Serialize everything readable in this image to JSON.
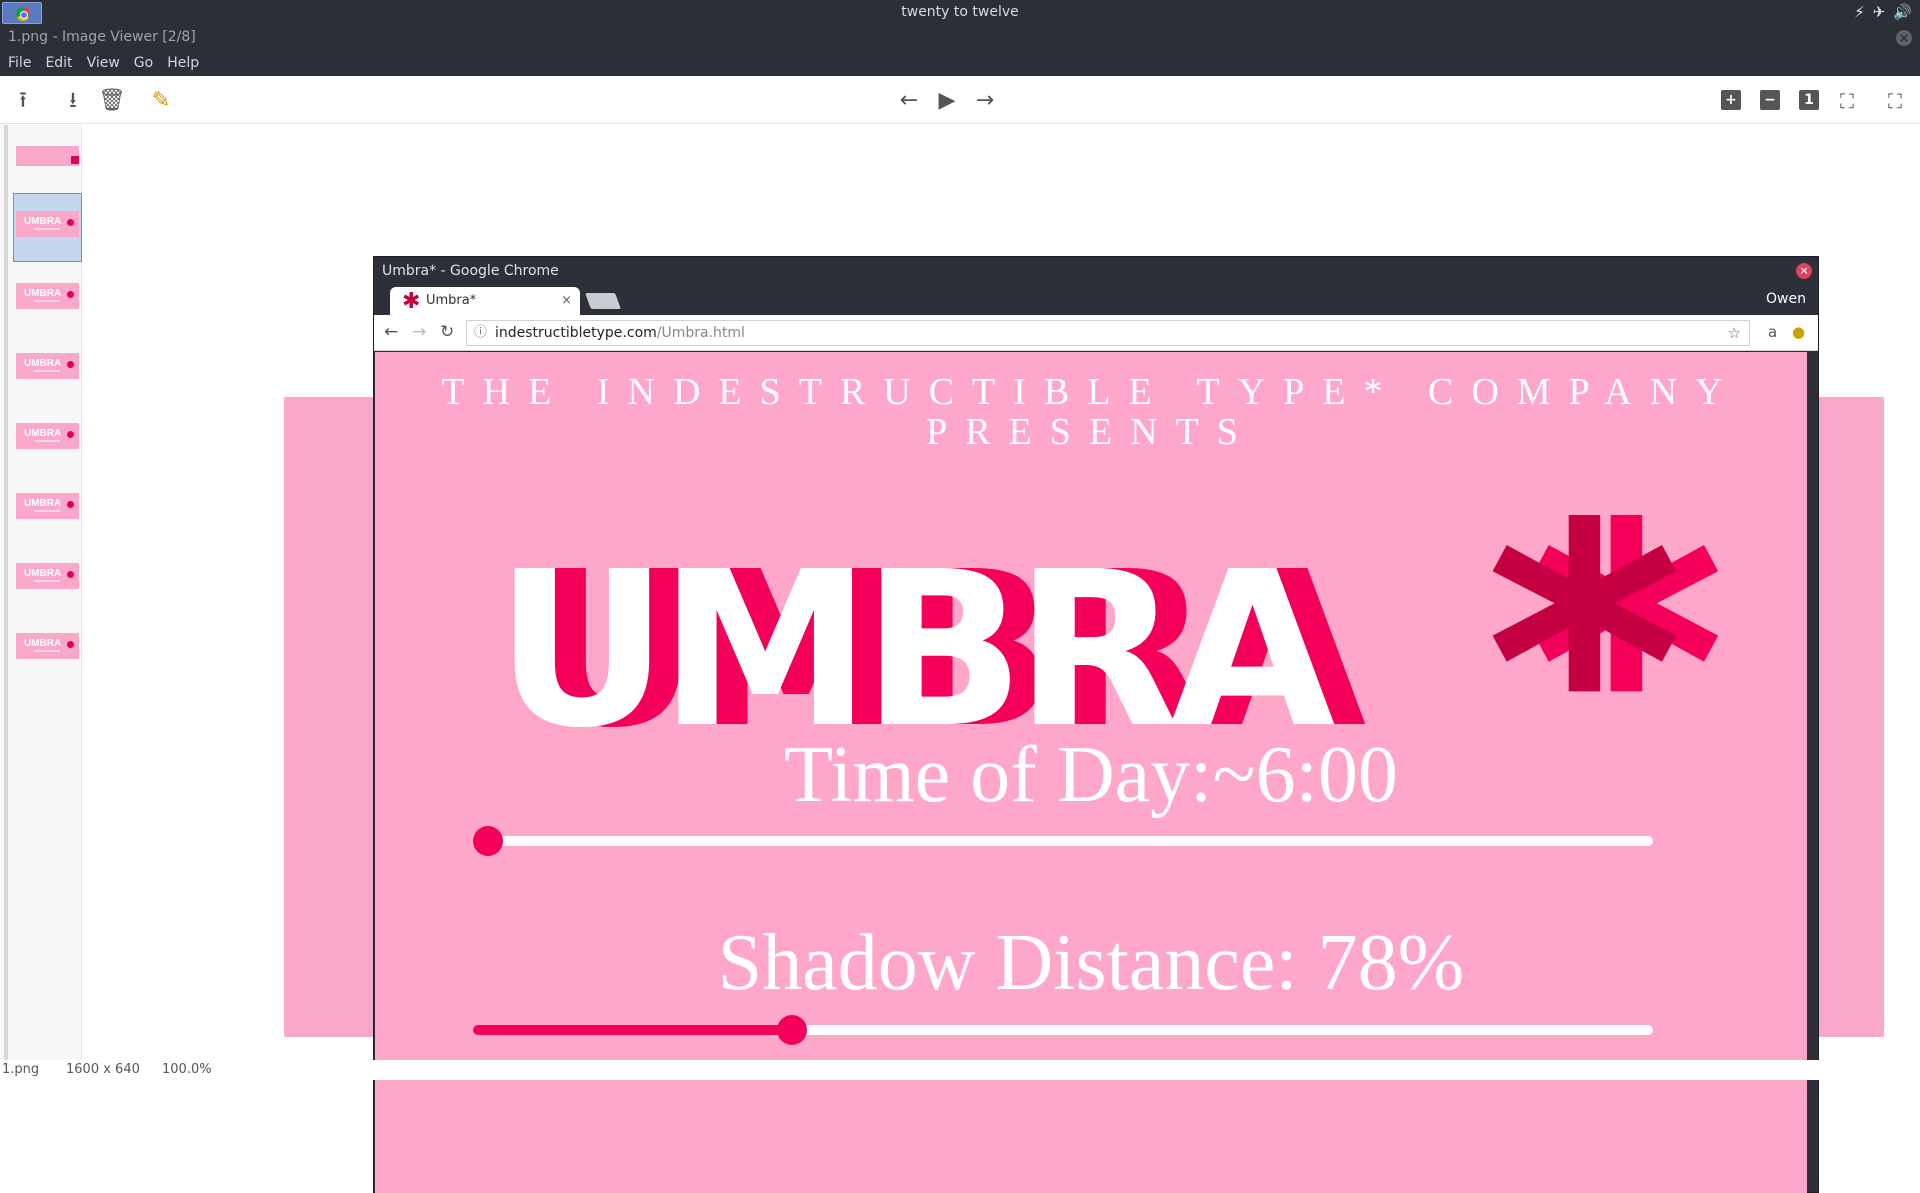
{
  "system": {
    "clock": "twenty to twelve"
  },
  "viewer": {
    "title": "1.png - Image Viewer [2/8]",
    "menu": [
      "File",
      "Edit",
      "View",
      "Go",
      "Help"
    ],
    "thumb_text": "UMBRA",
    "status": {
      "filename": "1.png",
      "dimensions": "1600 x 640",
      "zoom": "100.0%"
    }
  },
  "browser": {
    "window_title": "Umbra* - Google Chrome",
    "tab_label": "Umbra*",
    "profile": "Owen",
    "url_host": "indestructibletype.com",
    "url_path": "/Umbra.html"
  },
  "page": {
    "heading_line1": "THE INDESTRUCTIBLE TYPE* COMPANY",
    "heading_line2": "PRESENTS",
    "logo_text": "UMBRA",
    "logo_asterisk": "*",
    "time_label": "Time of Day:~6:00",
    "time_slider_value": 0,
    "shadow_label": "Shadow Distance: 78%",
    "shadow_slider_value": 0.27
  },
  "colors": {
    "page_bg": "#fea7c9",
    "accent": "#f4005a",
    "asterisk_dark": "#c40043"
  }
}
